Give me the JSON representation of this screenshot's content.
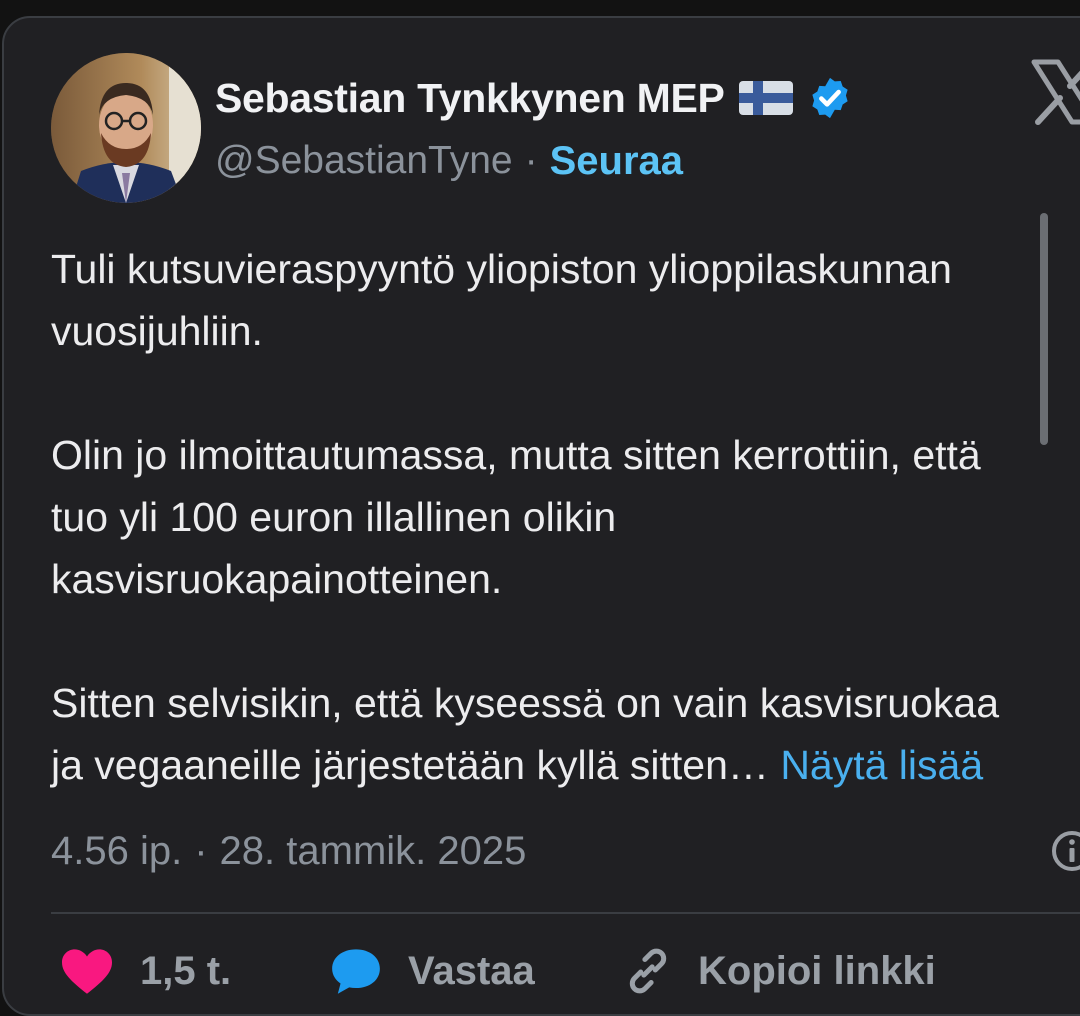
{
  "author": {
    "display_name": "Sebastian Tynkkynen MEP",
    "handle": "@SebastianTyne",
    "separator": "·",
    "follow_label": "Seuraa"
  },
  "tweet": {
    "paragraphs": [
      [
        "Tuli kutsuvieraspyyntö yliopiston ylioppilaskunnan",
        "vuosijuhliin."
      ],
      [
        "Olin jo ilmoittautumassa, mutta sitten kerrottiin, että",
        "tuo yli 100 euron illallinen olikin",
        "kasvisruokapainotteinen."
      ],
      [
        "Sitten selvisikin, että kyseessä on vain kasvisruokaa",
        "ja vegaaneille järjestetään kyllä sitten…"
      ]
    ],
    "show_more_label": "Näytä lisää",
    "time": "4.56 ip.",
    "date": "28. tammik. 2025"
  },
  "actions": {
    "like_count": "1,5 t.",
    "reply_label": "Vastaa",
    "copy_link_label": "Kopioi linkki"
  },
  "colors": {
    "background": "#202023",
    "accent": "#5cc3f5",
    "link": "#4ab0ef",
    "verified": "#1d9bf0",
    "like": "#f91880"
  }
}
